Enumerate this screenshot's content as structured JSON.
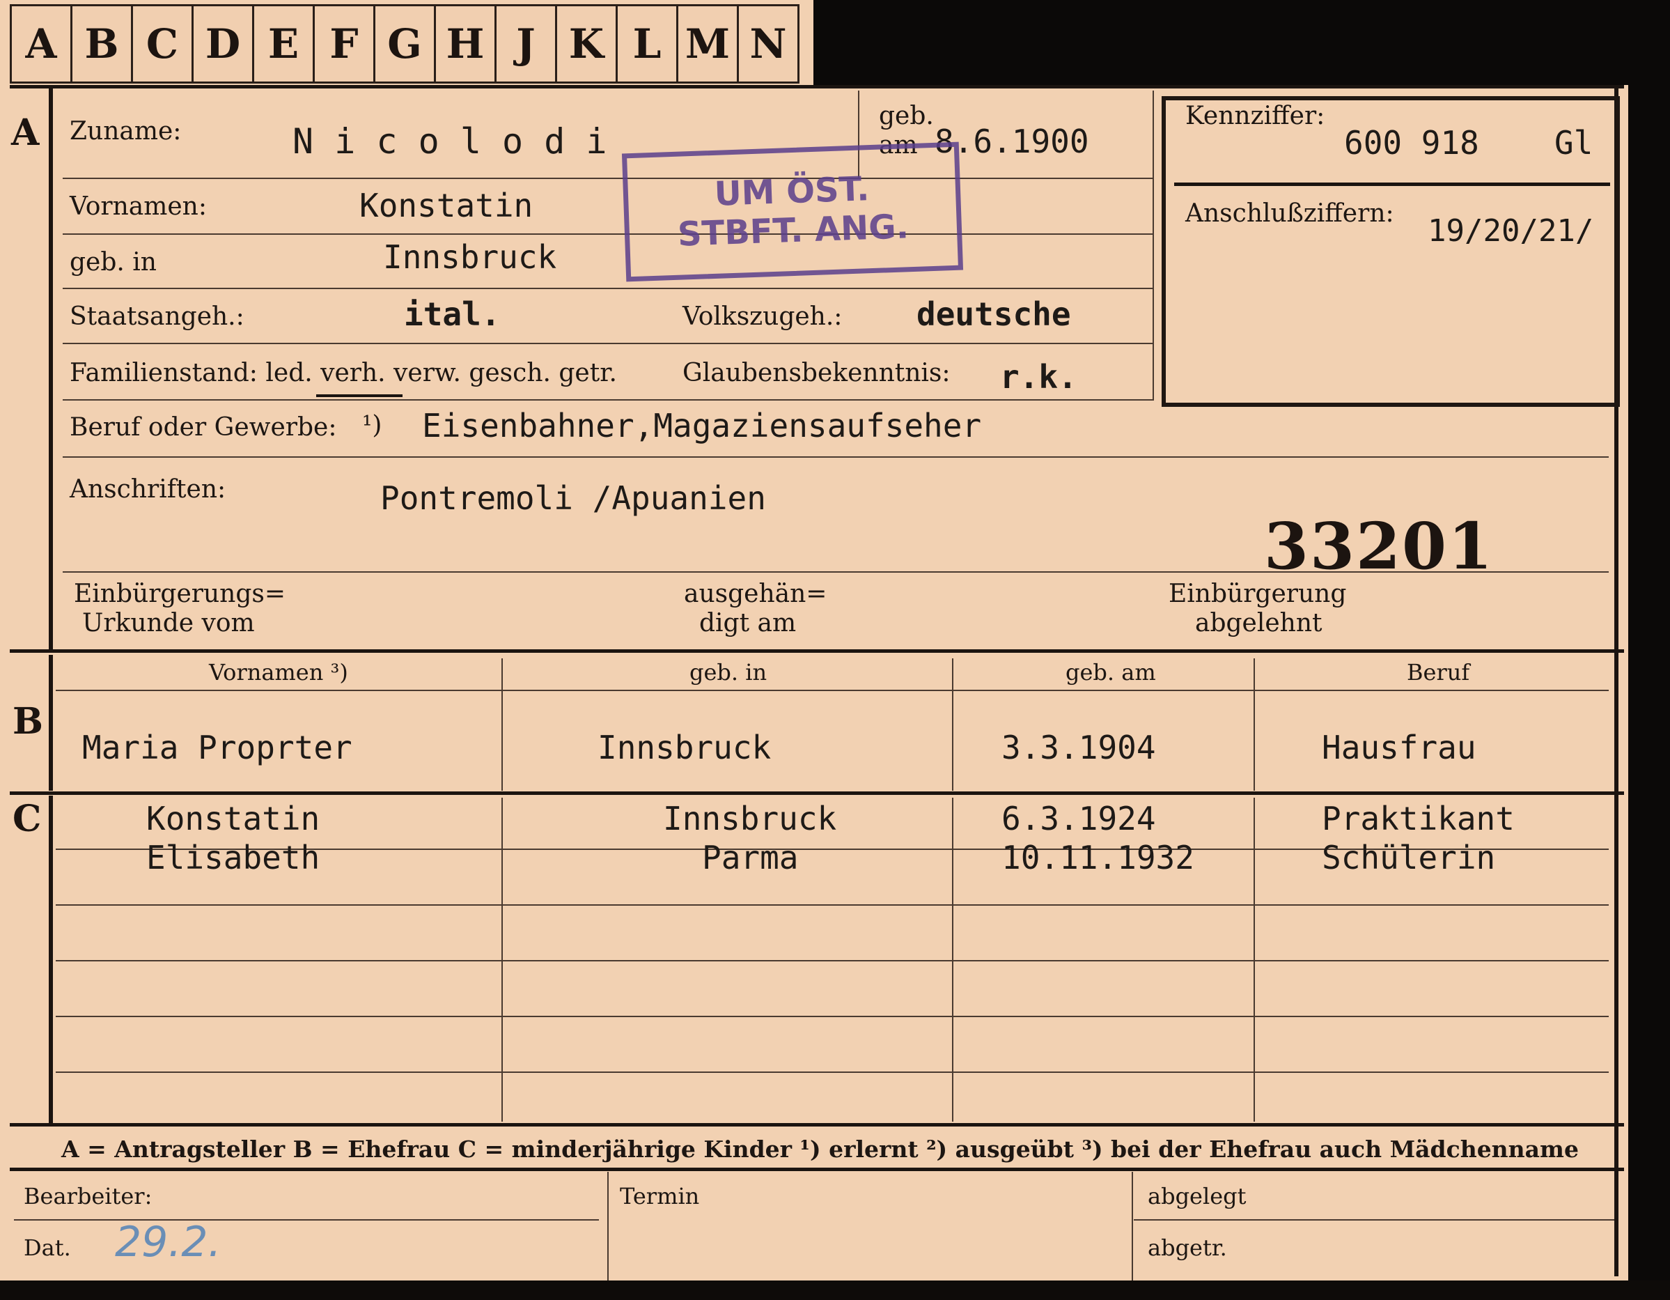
{
  "tabs": [
    "A",
    "B",
    "C",
    "D",
    "E",
    "F",
    "G",
    "H",
    "J",
    "K",
    "L",
    "M",
    "N"
  ],
  "sections": {
    "a": "A",
    "b": "B",
    "c": "C"
  },
  "applicant": {
    "surname_label": "Zuname:",
    "surname": "N i c o l o d i",
    "born_on_label_1": "geb.",
    "born_on_label_2": "am",
    "born_on": "8.6.1900",
    "firstnames_label": "Vornamen:",
    "firstnames": "Konstatin",
    "birthplace_label": "geb. in",
    "birthplace": "Innsbruck",
    "citizenship_label": "Staatsangeh.:",
    "citizenship": "ital.",
    "ethnicity_label": "Volkszugeh.:",
    "ethnicity": "deutsche",
    "family_status_label": "Familienstand: led. verh. verw. gesch. getr.",
    "religion_label": "Glaubensbekenntnis:",
    "religion": "r.k.",
    "profession_label": "Beruf oder Gewerbe:",
    "profession_mark": "¹)",
    "profession": "Eisenbahner,Magaziensaufseher",
    "address_label": "Anschriften:",
    "address": "Pontremoli /Apuanien",
    "naturalization_label_1": "Einbürgerungs=",
    "naturalization_label_2": "Urkunde vom",
    "handed_label_1": "ausgehän=",
    "handed_label_2": "digt am",
    "refused_label_1": "Einbürgerung",
    "refused_label_2": "abgelehnt"
  },
  "id_box": {
    "id_label": "Kennziffer:",
    "id_value": "600 918",
    "id_suffix": "Gl",
    "linked_label": "Anschlußziffern:",
    "linked_value": "19/20/21/"
  },
  "stamp": {
    "line1": "UM ÖST.",
    "line2": "STBFT. ANG."
  },
  "case_number": "33201",
  "table": {
    "headers": [
      "Vornamen ³)",
      "geb. in",
      "geb. am",
      "Beruf"
    ],
    "spouse": {
      "name": "Maria Proprter",
      "place": "Innsbruck",
      "date": "3.3.1904",
      "job": "Hausfrau"
    },
    "children": [
      {
        "name": "Konstatin",
        "place": "Innsbruck",
        "date": "6.3.1924",
        "job": "Praktikant"
      },
      {
        "name": "Elisabeth",
        "place": "Parma",
        "date": "10.11.1932",
        "job": "Schülerin"
      }
    ]
  },
  "legend": "A = Antragsteller   B = Ehefrau   C = minderjährige Kinder   ¹) erlernt   ²) ausgeübt   ³) bei der Ehefrau auch Mädchenname",
  "footer": {
    "editor_label": "Bearbeiter:",
    "date_label": "Dat.",
    "date_value": "29.2.",
    "deadline_label": "Termin",
    "filed_label": "abgelegt",
    "sent_label": "abgetr."
  }
}
